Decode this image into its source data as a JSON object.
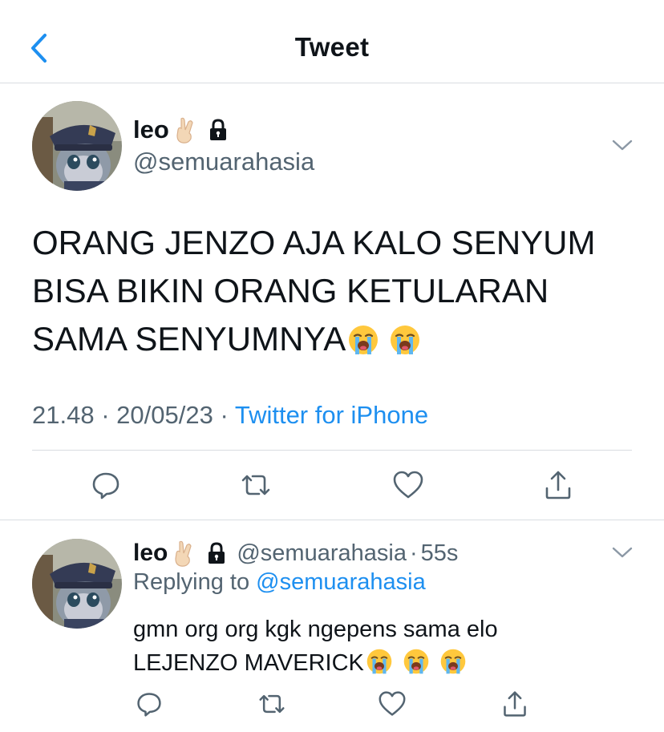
{
  "header": {
    "title": "Tweet"
  },
  "tweet": {
    "author_name": "leo",
    "handle": "@semuarahasia",
    "text": "ORANG JENZO AJA KALO SENYUM BISA BIKIN ORANG KETULARAN SAMA SENYUMNYA",
    "time": "21.48",
    "separator": "·",
    "date": "20/05/23",
    "source": "Twitter for iPhone"
  },
  "reply": {
    "author_name": "leo",
    "handle": "@semuarahasia",
    "separator": "·",
    "time_ago": "55s",
    "replying_prefix": "Replying to",
    "replying_to": "@semuarahasia",
    "text_line1": "gmn org org kgk ngepens sama elo",
    "text_line2": "LEJENZO MAVERICK"
  },
  "icons": {
    "back": "chevron-left-icon",
    "lock": "lock-icon",
    "fingers": "crossed-fingers-emoji",
    "cry": "loudly-crying-face-emoji",
    "more": "chevron-down-icon",
    "reply": "reply-bubble-icon",
    "retweet": "retweet-icon",
    "like": "heart-icon",
    "share": "share-icon"
  },
  "colors": {
    "accent": "#1d8ff0",
    "secondary_text": "#536471",
    "divider": "#d9dde1",
    "icon": "#536471"
  }
}
